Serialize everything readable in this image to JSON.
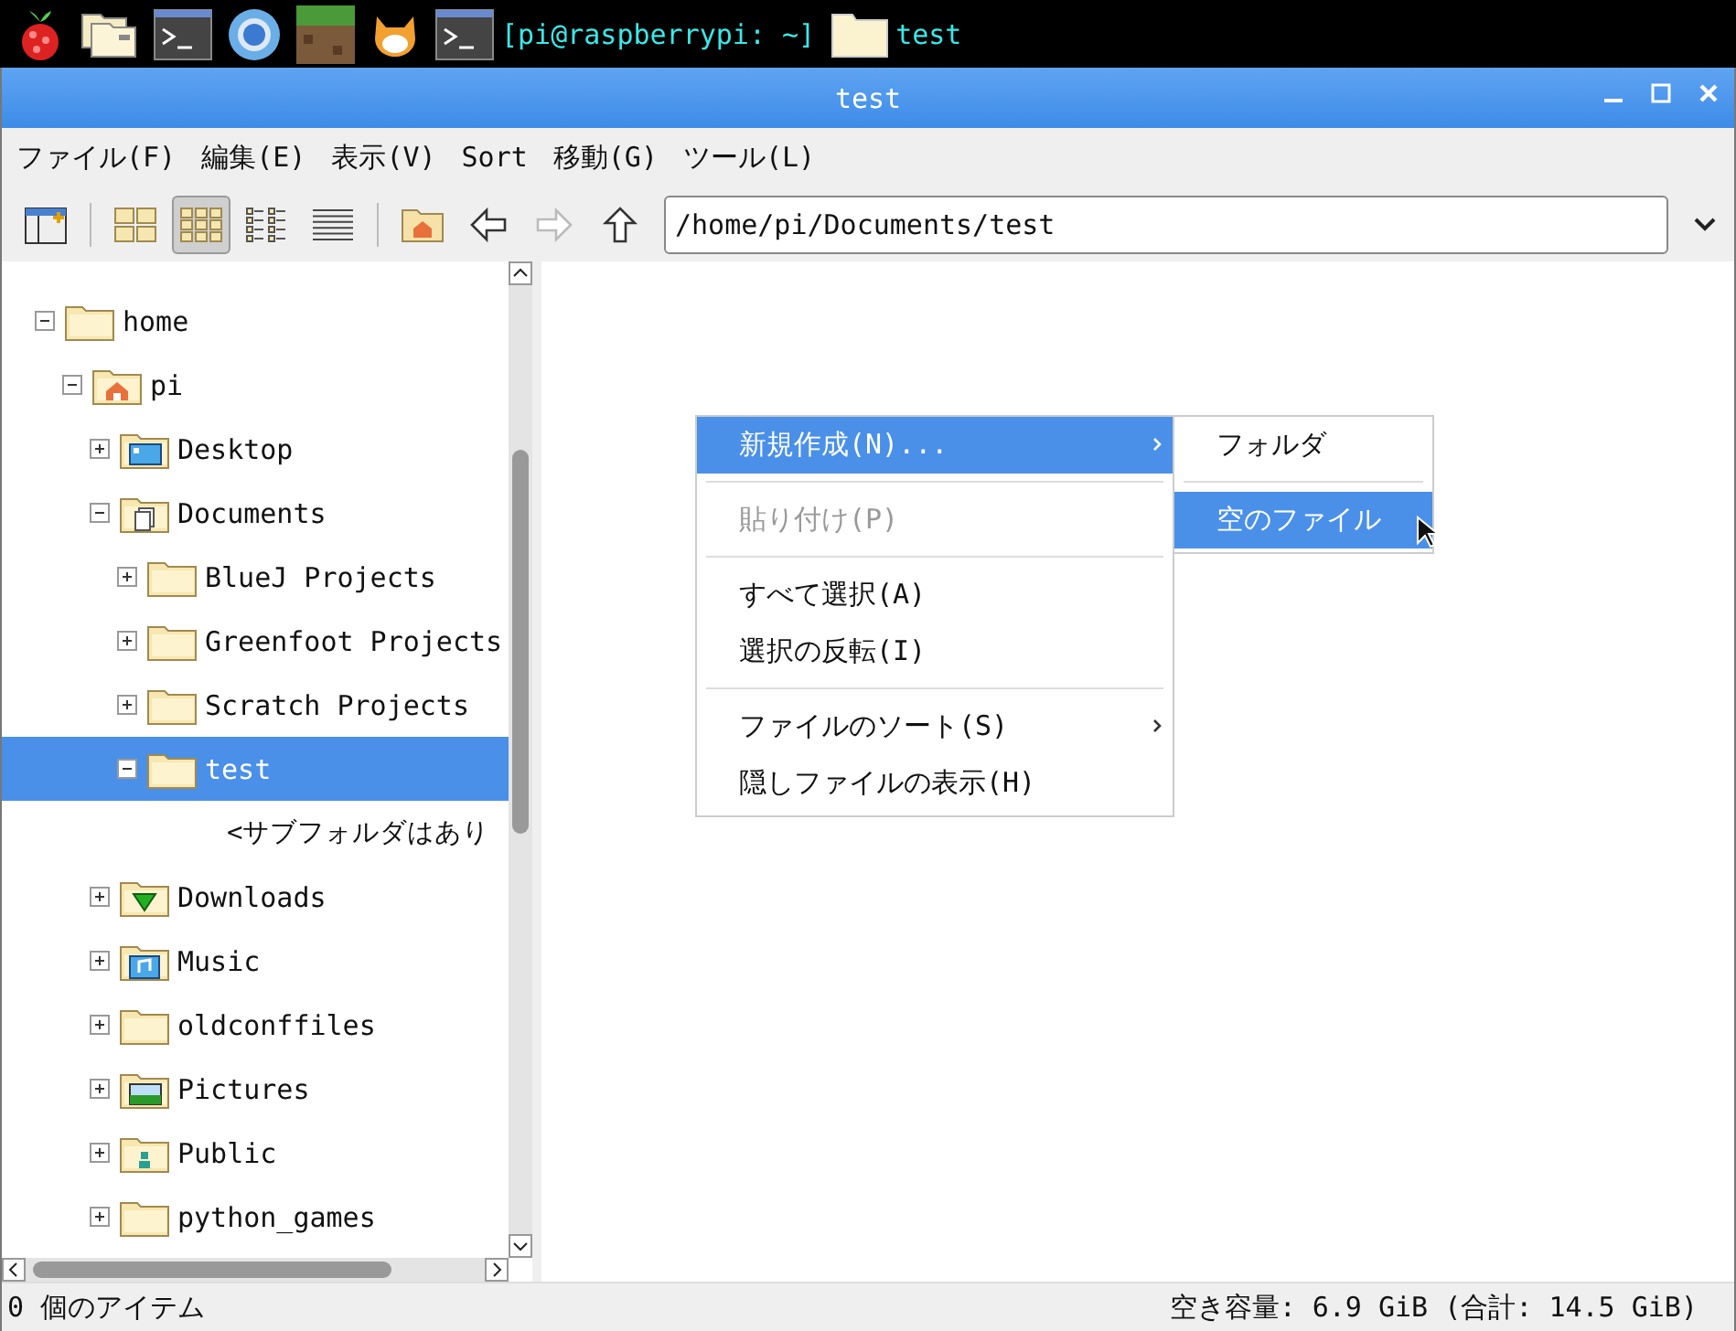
{
  "taskbar": {
    "apps": [
      {
        "kind": "raspberry"
      },
      {
        "kind": "files"
      },
      {
        "kind": "terminal"
      },
      {
        "kind": "browser"
      },
      {
        "kind": "blocks"
      },
      {
        "kind": "cat"
      }
    ],
    "windows": [
      {
        "kind": "terminal",
        "label": "[pi@raspberrypi: ~]"
      },
      {
        "kind": "folder",
        "label": "test"
      }
    ]
  },
  "window": {
    "title": "test"
  },
  "menubar": [
    "ファイル(F)",
    "編集(E)",
    "表示(V)",
    "Sort",
    "移動(G)",
    "ツール(L)"
  ],
  "toolbar": {
    "views": [
      {
        "kind": "icons",
        "selected": false
      },
      {
        "kind": "thumbnails",
        "selected": true
      },
      {
        "kind": "compact",
        "selected": false
      },
      {
        "kind": "list",
        "selected": false
      }
    ],
    "forward_disabled": true,
    "path": "/home/pi/Documents/test"
  },
  "tree": [
    {
      "label": "home",
      "kind": "folder",
      "expanded": true,
      "selected": false,
      "children": [
        {
          "label": "pi",
          "kind": "home",
          "expanded": true,
          "selected": false,
          "children": [
            {
              "label": "Desktop",
              "kind": "desktop",
              "expanded": false,
              "selected": false
            },
            {
              "label": "Documents",
              "kind": "documents",
              "expanded": true,
              "selected": false,
              "children": [
                {
                  "label": "BlueJ Projects",
                  "kind": "folder",
                  "expanded": false,
                  "selected": false
                },
                {
                  "label": "Greenfoot Projects",
                  "kind": "folder",
                  "expanded": false,
                  "selected": false
                },
                {
                  "label": "Scratch Projects",
                  "kind": "folder",
                  "expanded": false,
                  "selected": false
                },
                {
                  "label": "test",
                  "kind": "folder",
                  "expanded": true,
                  "selected": true,
                  "children": [
                    {
                      "label": "<サブフォルダはあり",
                      "kind": "placeholder"
                    }
                  ]
                }
              ]
            },
            {
              "label": "Downloads",
              "kind": "downloads",
              "expanded": false,
              "selected": false
            },
            {
              "label": "Music",
              "kind": "music",
              "expanded": false,
              "selected": false
            },
            {
              "label": "oldconffiles",
              "kind": "folder",
              "expanded": false,
              "selected": false
            },
            {
              "label": "Pictures",
              "kind": "pictures",
              "expanded": false,
              "selected": false
            },
            {
              "label": "Public",
              "kind": "public",
              "expanded": false,
              "selected": false
            },
            {
              "label": "python_games",
              "kind": "folder",
              "expanded": false,
              "selected": false
            }
          ]
        }
      ]
    }
  ],
  "context_menu": {
    "items": [
      {
        "kind": "item",
        "label": "新規作成(N)...",
        "submenu": true,
        "disabled": false,
        "selected": true
      },
      {
        "kind": "separator"
      },
      {
        "kind": "item",
        "label": "貼り付け(P)",
        "submenu": false,
        "disabled": true,
        "selected": false
      },
      {
        "kind": "separator"
      },
      {
        "kind": "item",
        "label": "すべて選択(A)",
        "submenu": false,
        "disabled": false,
        "selected": false
      },
      {
        "kind": "item",
        "label": "選択の反転(I)",
        "submenu": false,
        "disabled": false,
        "selected": false
      },
      {
        "kind": "separator"
      },
      {
        "kind": "item",
        "label": "ファイルのソート(S)",
        "submenu": true,
        "disabled": false,
        "selected": false
      },
      {
        "kind": "item",
        "label": "隠しファイルの表示(H)",
        "submenu": false,
        "disabled": false,
        "selected": false
      }
    ],
    "submenu": [
      {
        "kind": "item",
        "label": "フォルダ",
        "selected": false
      },
      {
        "kind": "separator"
      },
      {
        "kind": "item",
        "label": "空のファイル",
        "selected": true
      }
    ]
  },
  "status_bar": {
    "left": "0 個のアイテム",
    "right": "空き容量: 6.9 GiB (合計: 14.5 GiB)"
  }
}
